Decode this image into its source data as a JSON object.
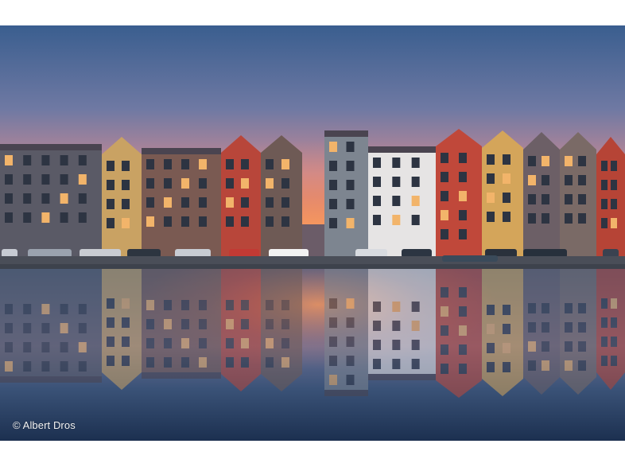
{
  "photo": {
    "subject": "canal-houses-sunset-reflection",
    "credit": "© Albert Dros"
  },
  "palette": {
    "sky_top": "#3b5f8f",
    "sky_mid": "#8e7ea3",
    "sky_glow": "#f08a5d",
    "water_dark": "#1f3656",
    "water_glow": "#e8875c",
    "quay": "#4a4e58"
  }
}
